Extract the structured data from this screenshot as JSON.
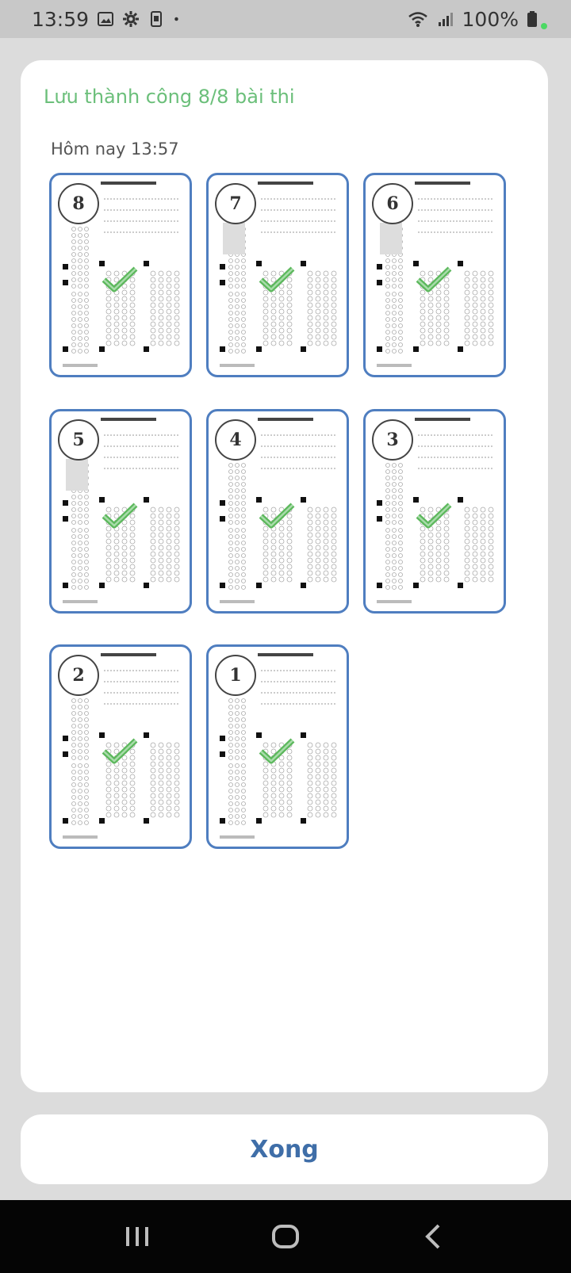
{
  "status_bar": {
    "time": "13:59",
    "battery": "100%",
    "icons": [
      "gallery-icon",
      "settings-gear-icon",
      "screen-recorder-icon",
      "dot-icon",
      "wifi-icon",
      "signal-icon",
      "battery-icon"
    ]
  },
  "dialog": {
    "title": "Lưu thành công 8/8 bài thi",
    "group_label": "Hôm nay 13:57",
    "sheets": [
      {
        "number": "8"
      },
      {
        "number": "7"
      },
      {
        "number": "6"
      },
      {
        "number": "5"
      },
      {
        "number": "4"
      },
      {
        "number": "3"
      },
      {
        "number": "2"
      },
      {
        "number": "1"
      }
    ]
  },
  "done_button": {
    "label": "Xong"
  },
  "nav_bar": {
    "icons": [
      "recent-apps-icon",
      "home-icon",
      "back-icon"
    ]
  },
  "colors": {
    "title_green": "#6bbf7a",
    "thumb_border": "#4f7ec0",
    "check_green": "#5cb85c",
    "button_text": "#3f6ea8"
  }
}
